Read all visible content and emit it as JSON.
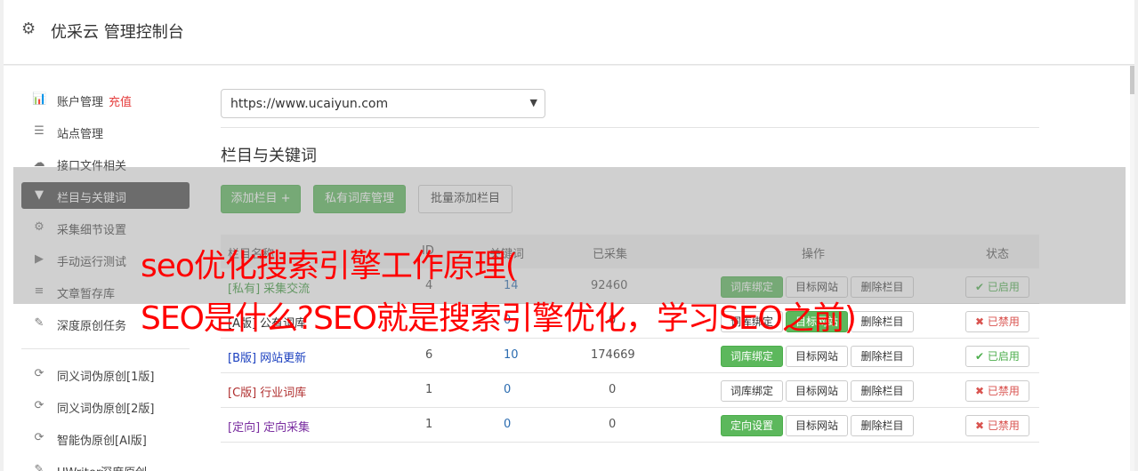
{
  "header": {
    "title": "优采云 管理控制台"
  },
  "sidebar": {
    "items": [
      {
        "icon": "bar-chart-icon",
        "glyph": "📊",
        "label": "账户管理",
        "extra": "充值"
      },
      {
        "icon": "server-icon",
        "glyph": "☰",
        "label": "站点管理"
      },
      {
        "icon": "cloud-upload-icon",
        "glyph": "☁",
        "label": "接口文件相关"
      },
      {
        "icon": "filter-icon",
        "glyph": "▼",
        "label": "栏目与关键词",
        "active": true
      },
      {
        "icon": "gears-icon",
        "glyph": "⚙",
        "label": "采集细节设置"
      },
      {
        "icon": "play-icon",
        "glyph": "▶",
        "label": "手动运行测试"
      },
      {
        "icon": "database-icon",
        "glyph": "≡",
        "label": "文章暂存库"
      },
      {
        "icon": "edit-icon",
        "glyph": "✎",
        "label": "深度原创任务"
      },
      {
        "icon": "refresh-icon",
        "glyph": "⟳",
        "label": "同义词伪原创[1版]"
      },
      {
        "icon": "refresh-icon",
        "glyph": "⟳",
        "label": "同义词伪原创[2版]"
      },
      {
        "icon": "refresh-icon",
        "glyph": "⟳",
        "label": "智能伪原创[AI版]"
      },
      {
        "icon": "edit-icon",
        "glyph": "✎",
        "label": "UWriter深度原创"
      }
    ]
  },
  "site_select": {
    "value": "https://www.ucaiyun.com"
  },
  "section_title": "栏目与关键词",
  "toolbar": {
    "add_column": "添加栏目 +",
    "private_lib": "私有词库管理",
    "batch_add": "批量添加栏目"
  },
  "table": {
    "headers": {
      "name": "栏目名称",
      "id": "ID",
      "words": "关键词",
      "collected": "已采集",
      "ops": "操作",
      "status": "状态"
    },
    "rows": [
      {
        "tag": "[私有]",
        "name": "采集交流",
        "id": "4",
        "words": "14",
        "collected": "92460",
        "bind": "词库绑定",
        "bind_green": true,
        "target": "目标网站",
        "target_green": false,
        "delete": "删除栏目",
        "status": "已启用",
        "on": true,
        "color": "#3c9a3c"
      },
      {
        "tag": "[A版]",
        "name": "公有词库",
        "id": "",
        "words": "0",
        "collected": "0",
        "bind": "词库绑定",
        "bind_green": false,
        "target": "目标网站",
        "target_green": true,
        "delete": "删除栏目",
        "status": "已禁用",
        "on": false,
        "color": "#333333"
      },
      {
        "tag": "[B版]",
        "name": "网站更新",
        "id": "6",
        "words": "10",
        "collected": "174669",
        "bind": "词库绑定",
        "bind_green": true,
        "target": "目标网站",
        "target_green": false,
        "delete": "删除栏目",
        "status": "已启用",
        "on": true,
        "color": "#1a3fbf"
      },
      {
        "tag": "[C版]",
        "name": "行业词库",
        "id": "1",
        "words": "0",
        "collected": "0",
        "bind": "词库绑定",
        "bind_green": false,
        "target": "目标网站",
        "target_green": false,
        "delete": "删除栏目",
        "status": "已禁用",
        "on": false,
        "color": "#b03030"
      },
      {
        "tag": "[定向]",
        "name": "定向采集",
        "id": "1",
        "words": "0",
        "collected": "0",
        "bind": "定向设置",
        "bind_green": true,
        "target": "目标网站",
        "target_green": false,
        "delete": "删除栏目",
        "status": "已禁用",
        "on": false,
        "color": "#7a2ea0"
      }
    ]
  },
  "overlay": {
    "line1": "seo优化搜索引擎工作原理(",
    "line2": "SEO是什么?SEO就是搜索引擎优化，学习SEO之前)"
  },
  "colors": {
    "green": "#5cb85c",
    "active": "#4a4a4a",
    "overlay_text": "#ff0000",
    "words_blue": "#2b6cb0"
  }
}
